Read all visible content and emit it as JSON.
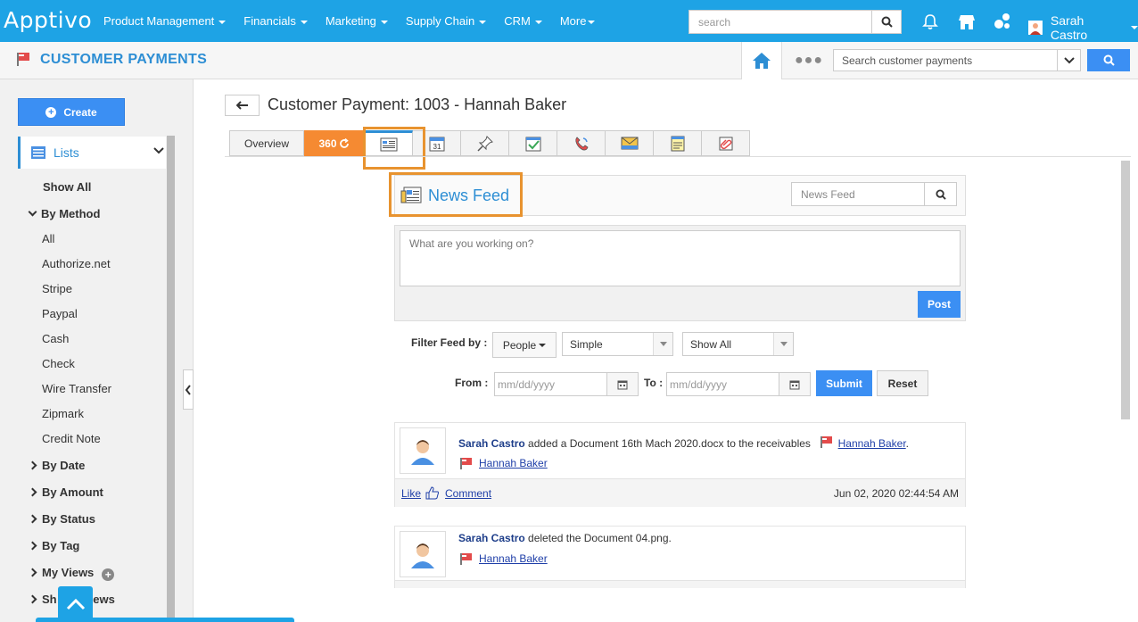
{
  "app": {
    "logo": "Apptivo",
    "user_name": "Sarah Castro"
  },
  "nav": [
    "Product Management",
    "Financials",
    "Marketing",
    "Supply Chain",
    "CRM",
    "More"
  ],
  "global_search": {
    "placeholder": "search"
  },
  "subheader": {
    "title": "CUSTOMER PAYMENTS",
    "search_placeholder": "Search customer payments"
  },
  "sidebar": {
    "create_label": "Create",
    "lists_label": "Lists",
    "show_all": "Show All",
    "by_method": "By Method",
    "methods": [
      "All",
      "Authorize.net",
      "Stripe",
      "Paypal",
      "Cash",
      "Check",
      "Wire Transfer",
      "Zipmark",
      "Credit Note"
    ],
    "groups": [
      "By Date",
      "By Amount",
      "By Status",
      "By Tag",
      "My Views"
    ],
    "shared_views": "Shared Views",
    "shared_views_visible": "Sh",
    "shared_views_tail": "iews"
  },
  "record": {
    "title": "Customer Payment: 1003 - Hannah Baker"
  },
  "tabs": {
    "overview": "Overview",
    "t360": "360",
    "icons": [
      "newsfeed-icon",
      "calendar-icon",
      "pin-icon",
      "task-icon",
      "call-icon",
      "email-icon",
      "note-icon",
      "attachment-icon"
    ],
    "calendar_day": "31"
  },
  "news_feed": {
    "title": "News Feed",
    "search_placeholder": "News Feed",
    "post_placeholder": "What are you working on?",
    "post_label": "Post",
    "filter_label": "Filter Feed by :",
    "people_label": "People",
    "type_value": "Simple",
    "show_value": "Show All",
    "from_label": "From :",
    "to_label": "To :",
    "date_placeholder": "mm/dd/yyyy",
    "submit_label": "Submit",
    "reset_label": "Reset"
  },
  "feed_items": [
    {
      "user": "Sarah Castro",
      "text": "added a Document 16th Mach 2020.docx to the receivables",
      "ref": "Hannah Baker",
      "ref2": "Hannah Baker",
      "like": "Like",
      "comment": "Comment",
      "timestamp": "Jun 02, 2020 02:44:54 AM"
    },
    {
      "user": "Sarah Castro",
      "text": "deleted the Document 04.png.",
      "ref2": "Hannah Baker"
    }
  ],
  "colors": {
    "topbar": "#1ea3e5",
    "accent": "#2d8ed4",
    "button": "#3b8ff3",
    "highlight": "#e8932f",
    "tab360": "#f58a32"
  }
}
